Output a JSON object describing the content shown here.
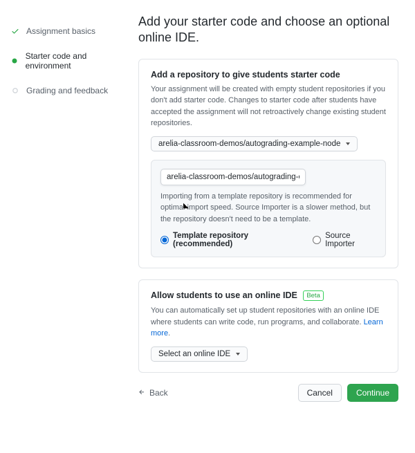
{
  "sidebar": {
    "items": [
      {
        "label": "Assignment basics",
        "state": "done"
      },
      {
        "label": "Starter code and environment",
        "state": "active"
      },
      {
        "label": "Grading and feedback",
        "state": "todo"
      }
    ]
  },
  "page": {
    "title": "Add your starter code and choose an optional online IDE."
  },
  "repo_panel": {
    "heading": "Add a repository to give students starter code",
    "desc": "Your assignment will be created with empty student repositories if you don't add starter code. Changes to starter code after students have accepted the assignment will not retroactively change existing student repositories.",
    "select_label": "arelia-classroom-demos/autograding-example-node",
    "filter_value": "arelia-classroom-demos/autograding-example-node",
    "note": "Importing from a template repository is recommended for optimal import speed. Source Importer is a slower method, but the repository doesn't need to be a template.",
    "radios": {
      "template": "Template repository (recommended)",
      "source": "Source Importer"
    }
  },
  "ide_panel": {
    "heading_text": "Allow students to use an online IDE",
    "badge": "Beta",
    "desc_text": "You can automatically set up student repositories with an online IDE where students can write code, run programs, and collaborate. ",
    "learn_more": "Learn more",
    "punct": ".",
    "select_label": "Select an online IDE"
  },
  "footer": {
    "back": "Back",
    "cancel": "Cancel",
    "continue": "Continue"
  }
}
